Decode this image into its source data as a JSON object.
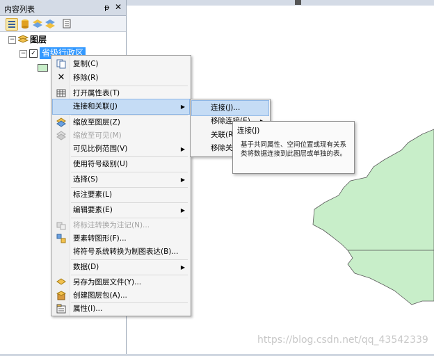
{
  "toc": {
    "title": "内容列表",
    "pin_glyph": "ᵽ",
    "close_glyph": "✕",
    "toolbar_icons": [
      "list-by-drawing-order-icon",
      "list-by-source-icon",
      "list-by-visibility-icon",
      "list-by-selection-icon",
      "options-icon"
    ],
    "tree": {
      "root_label": "图层",
      "layer_label": "省级行政区"
    }
  },
  "context_menu": {
    "items": [
      {
        "label": "复制(C)",
        "icon": "copy-icon"
      },
      {
        "label": "移除(R)",
        "icon": "remove-icon"
      },
      {
        "label": "打开属性表(T)",
        "icon": "table-icon"
      },
      {
        "label": "连接和关联(J)",
        "icon": "",
        "has_submenu": true,
        "highlighted": true
      },
      {
        "label": "缩放至图层(Z)",
        "icon": "zoom-to-layer-icon"
      },
      {
        "label": "缩放至可见(M)",
        "icon": "zoom-to-visible-icon",
        "disabled": true
      },
      {
        "label": "可见比例范围(V)",
        "icon": "",
        "has_submenu": true
      },
      {
        "label": "使用符号级别(U)",
        "icon": ""
      },
      {
        "label": "选择(S)",
        "icon": "",
        "has_submenu": true
      },
      {
        "label": "标注要素(L)",
        "icon": ""
      },
      {
        "label": "编辑要素(E)",
        "icon": "",
        "has_submenu": true
      },
      {
        "label": "将标注转换为注记(N)...",
        "icon": "convert-labels-icon",
        "disabled": true
      },
      {
        "label": "要素转图形(F)...",
        "icon": "features-to-graphics-icon"
      },
      {
        "label": "将符号系统转换为制图表达(B)...",
        "icon": ""
      },
      {
        "label": "数据(D)",
        "icon": "",
        "has_submenu": true
      },
      {
        "label": "另存为图层文件(Y)...",
        "icon": "layer-file-icon"
      },
      {
        "label": "创建图层包(A)...",
        "icon": "layer-package-icon"
      },
      {
        "label": "属性(I)...",
        "icon": "properties-icon"
      }
    ]
  },
  "submenu": {
    "items": [
      {
        "label": "连接(J)...",
        "highlighted": true
      },
      {
        "label": "移除连接(E)",
        "has_submenu": true
      },
      {
        "label": "关联(R)..."
      },
      {
        "label": "移除关联"
      }
    ]
  },
  "tooltip": {
    "title": "连接(J)",
    "body": "基于共同属性、空间位置或现有关系类将数据连接到此图层或单独的表。"
  },
  "watermark": "https://blog.csdn.net/qq_43542339",
  "colors": {
    "highlight": "#c5dcf5",
    "map_polygon": "#c8eec9",
    "selected_layer": "#3399ff"
  }
}
